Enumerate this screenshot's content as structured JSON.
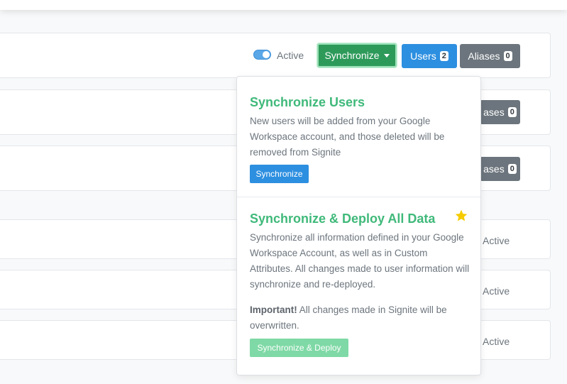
{
  "header": {},
  "rows": [
    {
      "status_label": "Active",
      "sync_button_label": "Synchronize",
      "users_label": "Users",
      "users_count": "2",
      "aliases_label": "Aliases",
      "aliases_count": "0"
    },
    {
      "aliases_label_partial": "ases",
      "aliases_count": "0"
    },
    {
      "aliases_label_partial": "ases",
      "aliases_count": "0"
    },
    {
      "status_label": "Active"
    },
    {
      "status_label": "Active"
    },
    {
      "status_label": "Active"
    }
  ],
  "dropdown": {
    "sync_users": {
      "title": "Synchronize Users",
      "description": "New users will be added from your Google Workspace account, and those deleted will be removed from Signite",
      "button_label": "Synchronize"
    },
    "sync_deploy": {
      "title": "Synchronize & Deploy All Data",
      "description": "Synchronize all information defined in your Google Workspace Account, as well as in Custom Attributes. All changes made to user information will synchronize and re-deployed.",
      "important_label": "Important!",
      "important_text": " All changes made in Signite will be overwritten.",
      "button_label": "Synchronize & Deploy",
      "icon": "star-icon"
    }
  },
  "colors": {
    "accent_green": "#3fb97a",
    "sync_button": "#2d9a5a",
    "primary_blue": "#2d8fe0",
    "secondary_gray": "#6c757d",
    "star_yellow": "#f5cc00"
  }
}
